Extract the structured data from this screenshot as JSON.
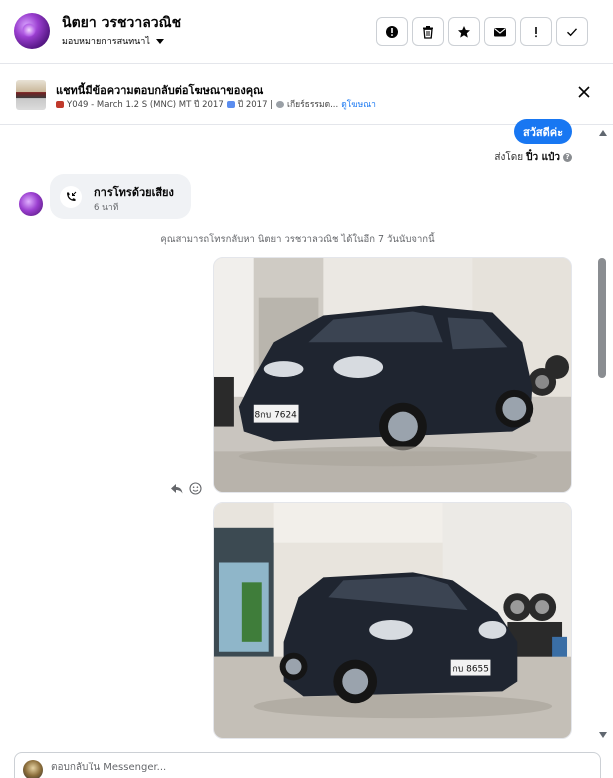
{
  "header": {
    "contact_name": "นิตยา วรชวาลวณิช",
    "assign_label": "มอบหมายการสนทนาไ",
    "actions": [
      {
        "name": "report-button",
        "icon": "alert-circle-icon"
      },
      {
        "name": "delete-button",
        "icon": "trash-icon"
      },
      {
        "name": "star-button",
        "icon": "star-icon"
      },
      {
        "name": "mark-unread-button",
        "icon": "envelope-icon"
      },
      {
        "name": "flag-button",
        "icon": "exclamation-icon"
      },
      {
        "name": "done-button",
        "icon": "check-icon"
      }
    ]
  },
  "ad_banner": {
    "title": "แชทนี้มีข้อความตอบกลับต่อโฆษณาของคุณ",
    "model": "Y049 - March 1.2 S (MNC) MT ปี 2017",
    "year": "ปี 2017 |",
    "gear": "เกียร์ธรรมด...",
    "view_ad_link": "ดูโฆษณา"
  },
  "thread": {
    "outgoing_message": "สวัสดีค่ะ",
    "sent_by_prefix": "ส่งโดย",
    "sent_by_name": "ปิ๋ว แป๋ว",
    "call_title": "การโทรด้วยเสียง",
    "call_time": "6 นาที",
    "callback_notice": "คุณสามารถโทรกลับหา นิตยา วรชวาลวณิช ได้ในอีก 7 วันนับจากนี้",
    "plate_1": "8กบ 7624",
    "plate_2": "กบ 8655"
  },
  "composer": {
    "placeholder": "ตอบกลับใน Messenger..."
  },
  "colors": {
    "accent": "#1877f2",
    "bubble_incoming": "#f0f2f5",
    "car_body": "#1f2530"
  }
}
